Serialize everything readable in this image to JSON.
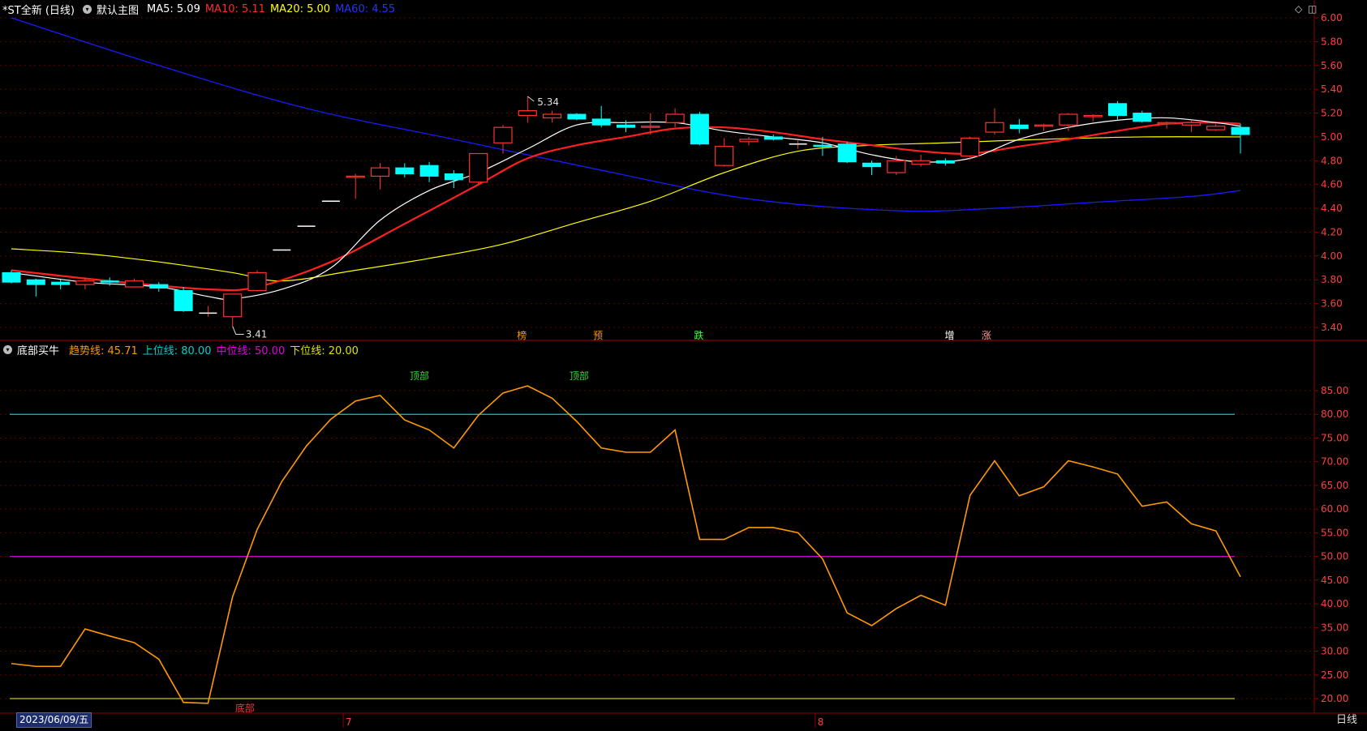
{
  "header": {
    "stock_title": "*ST全新 (日线)",
    "template_label": "默认主图",
    "ma5_text": "MA5: 5.09",
    "ma10_text": "MA10: 5.11",
    "ma20_text": "MA20: 5.00",
    "ma60_text": "MA60: 4.55"
  },
  "indicator_header": {
    "name": "底部买牛",
    "trend_text": "趋势线: 45.71",
    "upper_text": "上位线: 80.00",
    "middle_text": "中位线: 50.00",
    "lower_text": "下位线: 20.00"
  },
  "footer": {
    "date_label": "2023/06/09/五",
    "month_7": "7",
    "month_8": "8",
    "period_label": "日线"
  },
  "colors": {
    "background": "#000000",
    "up_candle": "#ff3232",
    "down_candle": "#00ffff",
    "ma5": "#ffffff",
    "ma10": "#ff2020",
    "ma20": "#ffff00",
    "ma60": "#1a1aff",
    "trend": "#ff9900",
    "upper_line": "#00c8c8",
    "middle_line": "#cc00cc",
    "lower_line": "#c8c800",
    "grid": "#5a0000",
    "axis_text": "#ff4040"
  },
  "chart_data": [
    {
      "type": "candlestick",
      "ylim": [
        3.3,
        6.1
      ],
      "yticks": [
        "6.00",
        "5.80",
        "5.60",
        "5.40",
        "5.20",
        "5.00",
        "4.80",
        "4.60",
        "4.40",
        "4.20",
        "4.00",
        "3.80",
        "3.60",
        "3.40"
      ],
      "ohlc": [
        [
          3.86,
          3.88,
          3.77,
          3.78
        ],
        [
          3.8,
          3.81,
          3.66,
          3.76
        ],
        [
          3.78,
          3.8,
          3.72,
          3.76
        ],
        [
          3.76,
          3.82,
          3.72,
          3.79
        ],
        [
          3.79,
          3.82,
          3.75,
          3.78
        ],
        [
          3.74,
          3.81,
          3.74,
          3.79
        ],
        [
          3.76,
          3.78,
          3.7,
          3.73
        ],
        [
          3.71,
          3.74,
          3.53,
          3.54
        ],
        [
          3.52,
          3.58,
          3.49,
          3.52
        ],
        [
          3.49,
          3.68,
          3.41,
          3.68
        ],
        [
          3.71,
          3.88,
          3.7,
          3.86
        ],
        [
          4.05,
          4.05,
          4.05,
          4.05
        ],
        [
          4.25,
          4.25,
          4.25,
          4.25
        ],
        [
          4.46,
          4.46,
          4.46,
          4.46
        ],
        [
          4.66,
          4.69,
          4.48,
          4.67
        ],
        [
          4.67,
          4.78,
          4.56,
          4.74
        ],
        [
          4.74,
          4.78,
          4.66,
          4.69
        ],
        [
          4.76,
          4.79,
          4.62,
          4.67
        ],
        [
          4.69,
          4.72,
          4.57,
          4.64
        ],
        [
          4.62,
          4.86,
          4.6,
          4.86
        ],
        [
          4.95,
          5.1,
          4.86,
          5.08
        ],
        [
          5.18,
          5.34,
          5.12,
          5.22
        ],
        [
          5.16,
          5.22,
          5.12,
          5.19
        ],
        [
          5.19,
          5.2,
          5.14,
          5.15
        ],
        [
          5.15,
          5.26,
          5.08,
          5.1
        ],
        [
          5.1,
          5.14,
          5.04,
          5.08
        ],
        [
          5.08,
          5.2,
          5.02,
          5.09
        ],
        [
          5.12,
          5.24,
          5.08,
          5.19
        ],
        [
          5.19,
          5.21,
          4.93,
          4.94
        ],
        [
          4.76,
          4.99,
          4.75,
          4.92
        ],
        [
          4.96,
          5.0,
          4.93,
          4.98
        ],
        [
          5.0,
          5.02,
          4.97,
          4.98
        ],
        [
          4.94,
          4.97,
          4.9,
          4.94
        ],
        [
          4.93,
          5.0,
          4.84,
          4.92
        ],
        [
          4.94,
          4.96,
          4.78,
          4.79
        ],
        [
          4.78,
          4.8,
          4.68,
          4.75
        ],
        [
          4.7,
          4.84,
          4.68,
          4.8
        ],
        [
          4.77,
          4.85,
          4.75,
          4.8
        ],
        [
          4.8,
          4.82,
          4.76,
          4.78
        ],
        [
          4.84,
          5.0,
          4.81,
          4.99
        ],
        [
          5.04,
          5.24,
          5.02,
          5.12
        ],
        [
          5.1,
          5.15,
          5.03,
          5.07
        ],
        [
          5.09,
          5.11,
          5.05,
          5.1
        ],
        [
          5.1,
          5.2,
          5.05,
          5.19
        ],
        [
          5.17,
          5.19,
          5.13,
          5.18
        ],
        [
          5.28,
          5.3,
          5.14,
          5.18
        ],
        [
          5.2,
          5.22,
          5.12,
          5.13
        ],
        [
          5.11,
          5.13,
          5.07,
          5.12
        ],
        [
          5.1,
          5.14,
          5.04,
          5.12
        ],
        [
          5.06,
          5.11,
          5.05,
          5.09
        ],
        [
          5.08,
          5.11,
          4.86,
          5.02
        ]
      ],
      "ma5": [
        [
          0,
          3.86
        ],
        [
          3,
          3.78
        ],
        [
          6,
          3.74
        ],
        [
          8,
          3.66
        ],
        [
          9,
          3.64
        ],
        [
          11,
          3.72
        ],
        [
          13,
          3.9
        ],
        [
          15,
          4.3
        ],
        [
          17,
          4.55
        ],
        [
          19,
          4.7
        ],
        [
          21,
          4.9
        ],
        [
          23,
          5.1
        ],
        [
          25,
          5.12
        ],
        [
          27,
          5.12
        ],
        [
          29,
          5.05
        ],
        [
          31,
          5.0
        ],
        [
          33,
          4.95
        ],
        [
          35,
          4.85
        ],
        [
          37,
          4.79
        ],
        [
          39,
          4.82
        ],
        [
          41,
          4.98
        ],
        [
          43,
          5.08
        ],
        [
          45,
          5.14
        ],
        [
          47,
          5.16
        ],
        [
          49,
          5.12
        ],
        [
          50,
          5.09
        ]
      ],
      "ma10": [
        [
          0,
          3.88
        ],
        [
          4,
          3.79
        ],
        [
          8,
          3.72
        ],
        [
          10,
          3.74
        ],
        [
          13,
          3.95
        ],
        [
          16,
          4.27
        ],
        [
          19,
          4.6
        ],
        [
          21,
          4.82
        ],
        [
          23,
          4.93
        ],
        [
          25,
          5.0
        ],
        [
          27,
          5.07
        ],
        [
          29,
          5.08
        ],
        [
          31,
          5.04
        ],
        [
          33,
          4.98
        ],
        [
          35,
          4.93
        ],
        [
          37,
          4.88
        ],
        [
          39,
          4.86
        ],
        [
          41,
          4.92
        ],
        [
          43,
          4.98
        ],
        [
          45,
          5.05
        ],
        [
          47,
          5.11
        ],
        [
          49,
          5.12
        ],
        [
          50,
          5.11
        ]
      ],
      "ma20": [
        [
          0,
          4.06
        ],
        [
          3,
          4.02
        ],
        [
          6,
          3.95
        ],
        [
          9,
          3.86
        ],
        [
          11,
          3.79
        ],
        [
          14,
          3.88
        ],
        [
          17,
          3.98
        ],
        [
          20,
          4.1
        ],
        [
          23,
          4.28
        ],
        [
          26,
          4.46
        ],
        [
          29,
          4.7
        ],
        [
          32,
          4.88
        ],
        [
          35,
          4.93
        ],
        [
          38,
          4.95
        ],
        [
          42,
          4.98
        ],
        [
          46,
          5.0
        ],
        [
          50,
          5.0
        ]
      ],
      "ma60": [
        [
          0,
          6.0
        ],
        [
          6,
          5.6
        ],
        [
          12,
          5.24
        ],
        [
          18,
          4.98
        ],
        [
          24,
          4.72
        ],
        [
          30,
          4.48
        ],
        [
          36,
          4.38
        ],
        [
          40,
          4.4
        ],
        [
          44,
          4.45
        ],
        [
          48,
          4.5
        ],
        [
          50,
          4.55
        ]
      ],
      "max_label": "5.34",
      "min_label": "3.41",
      "event_labels": [
        "榜",
        "预",
        "跌",
        "增",
        "涨"
      ]
    },
    {
      "type": "line",
      "title": "底部买牛",
      "ylim": [
        17,
        89
      ],
      "yticks": [
        "85.00",
        "80.00",
        "75.00",
        "70.00",
        "65.00",
        "60.00",
        "55.00",
        "50.00",
        "45.00",
        "40.00",
        "35.00",
        "30.00",
        "25.00",
        "20.00"
      ],
      "series": [
        {
          "name": "趋势线",
          "values": [
            27.4,
            26.8,
            26.8,
            34.7,
            33.2,
            31.8,
            28.3,
            19.2,
            19.0,
            41.5,
            55.7,
            65.8,
            73.3,
            79.0,
            82.8,
            84.0,
            78.8,
            76.7,
            72.9,
            79.8,
            84.5,
            86.0,
            83.4,
            78.5,
            72.9,
            72.0,
            72.0,
            76.7,
            53.6,
            53.6,
            56.1,
            56.1,
            55.0,
            49.5,
            38.1,
            35.4,
            39.0,
            41.8,
            39.7,
            62.9,
            70.2,
            62.8,
            64.7,
            70.2,
            68.9,
            67.4,
            60.6,
            61.5,
            56.9,
            55.4,
            45.7
          ]
        },
        {
          "name": "上位线",
          "values": [
            80.0
          ]
        },
        {
          "name": "中位线",
          "values": [
            50.0
          ]
        },
        {
          "name": "下位线",
          "values": [
            20.0
          ]
        }
      ],
      "annotations": [
        "顶部",
        "顶部",
        "底部"
      ]
    }
  ]
}
